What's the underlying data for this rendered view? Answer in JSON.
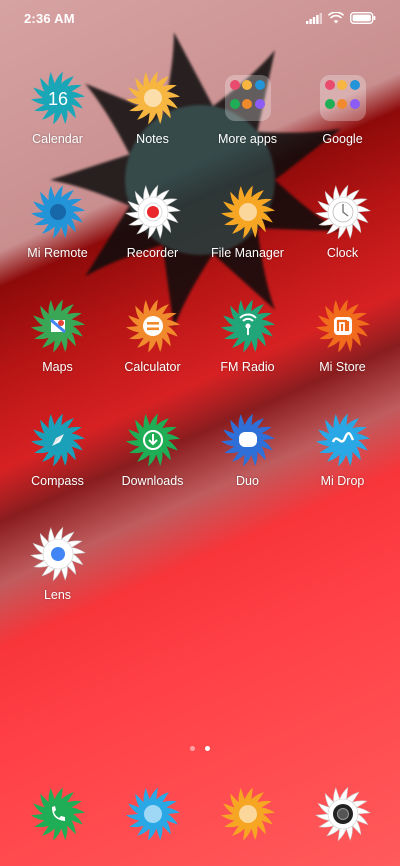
{
  "status_bar": {
    "time": "2:36 AM",
    "icons": [
      "signal-icon",
      "wifi-icon",
      "battery-icon"
    ]
  },
  "apps": [
    {
      "id": "calendar",
      "label": "Calendar",
      "color": "#19a7b8",
      "glyph": "16"
    },
    {
      "id": "notes",
      "label": "Notes",
      "color": "#f6b640",
      "glyph": "sun"
    },
    {
      "id": "more-apps",
      "label": "More apps",
      "folder": true
    },
    {
      "id": "google",
      "label": "Google",
      "folder": true
    },
    {
      "id": "mi-remote",
      "label": "Mi Remote",
      "color": "#2394d8",
      "glyph": "dot"
    },
    {
      "id": "recorder",
      "label": "Recorder",
      "color": "#ffffff",
      "glyph": "rec"
    },
    {
      "id": "file-manager",
      "label": "File Manager",
      "color": "#f6a623",
      "glyph": "sun"
    },
    {
      "id": "clock",
      "label": "Clock",
      "color": "#ffffff",
      "glyph": "clock"
    },
    {
      "id": "maps",
      "label": "Maps",
      "color": "#3aa757",
      "glyph": "maps"
    },
    {
      "id": "calculator",
      "label": "Calculator",
      "color": "#f08a2c",
      "glyph": "equals"
    },
    {
      "id": "fm-radio",
      "label": "FM Radio",
      "color": "#21a67a",
      "glyph": "radio"
    },
    {
      "id": "mi-store",
      "label": "Mi Store",
      "color": "#f06c1c",
      "glyph": "mi"
    },
    {
      "id": "compass",
      "label": "Compass",
      "color": "#1aa0b8",
      "glyph": "compass"
    },
    {
      "id": "downloads",
      "label": "Downloads",
      "color": "#1fae55",
      "glyph": "download"
    },
    {
      "id": "duo",
      "label": "Duo",
      "color": "#2f6fd8",
      "glyph": "duo"
    },
    {
      "id": "mi-drop",
      "label": "Mi Drop",
      "color": "#2aa8e6",
      "glyph": "wave"
    },
    {
      "id": "lens",
      "label": "Lens",
      "color": "#ffffff",
      "glyph": "lens"
    }
  ],
  "page_indicator": {
    "count": 2,
    "active": 2
  },
  "dock": [
    {
      "id": "phone",
      "color": "#1fae55",
      "glyph": "phone"
    },
    {
      "id": "messages",
      "color": "#2aa8e6",
      "glyph": "sun"
    },
    {
      "id": "browser",
      "color": "#f6a623",
      "glyph": "sun"
    },
    {
      "id": "camera",
      "color": "#ffffff",
      "glyph": "camera"
    }
  ]
}
